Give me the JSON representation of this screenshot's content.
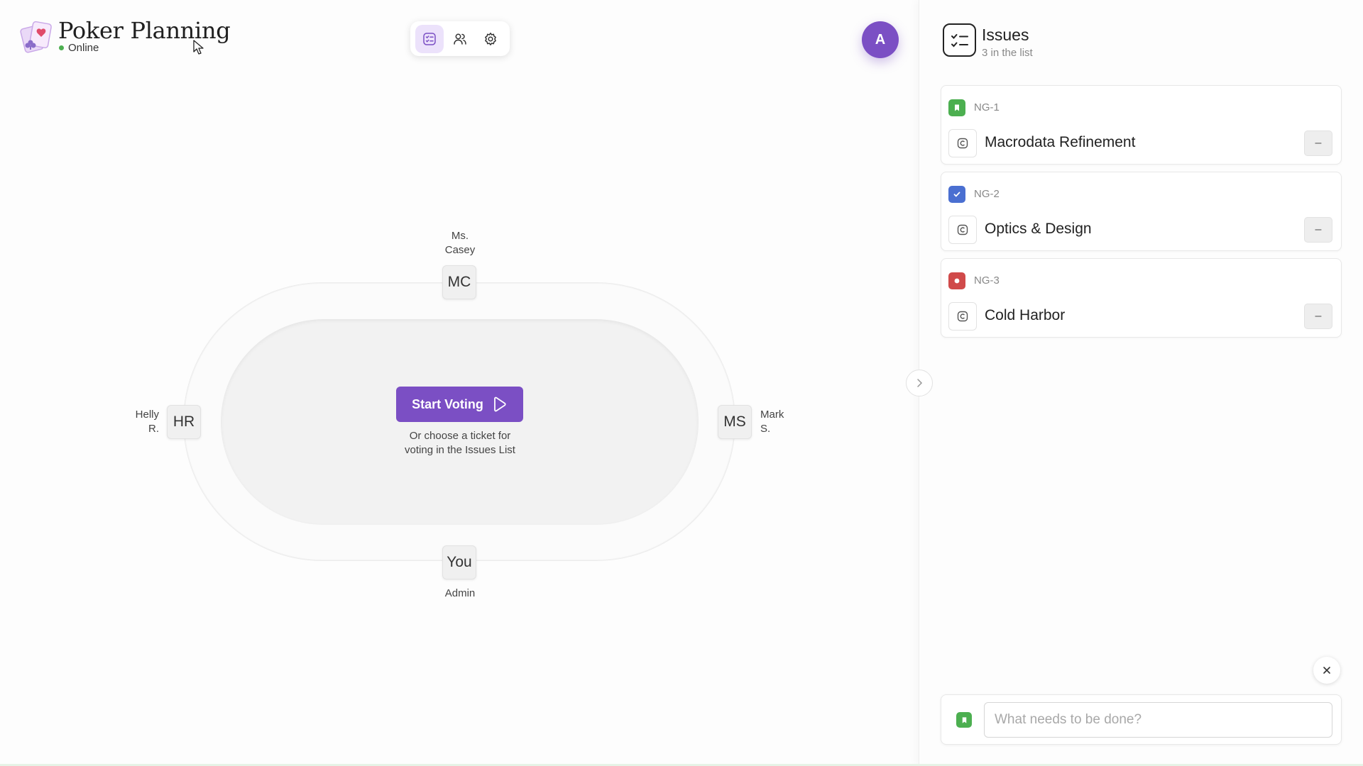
{
  "header": {
    "title": "Poker Planning",
    "status": "Online",
    "user_initial": "A"
  },
  "toolbar": {
    "buttons": [
      {
        "icon": "issues-list-icon",
        "active": true
      },
      {
        "icon": "users-icon",
        "active": false
      },
      {
        "icon": "settings-gear-icon",
        "active": false
      }
    ]
  },
  "table": {
    "start_button_label": "Start Voting",
    "hint_line1": "Or choose a ticket for",
    "hint_line2": "voting in the Issues List"
  },
  "players": {
    "top": {
      "initials": "MC",
      "name_line1": "Ms.",
      "name_line2": "Casey"
    },
    "left": {
      "initials": "HR",
      "name_line1": "Helly",
      "name_line2": "R."
    },
    "right": {
      "initials": "MS",
      "name_line1": "Mark",
      "name_line2": "S."
    },
    "bottom": {
      "initials": "You",
      "name": "Admin"
    }
  },
  "issues": {
    "title": "Issues",
    "count_text": "3 in the list",
    "items": [
      {
        "key": "NG-1",
        "title": "Macrodata Refinement",
        "type": "story",
        "type_color": "#4caf50",
        "menu": "–"
      },
      {
        "key": "NG-2",
        "title": "Optics & Design",
        "type": "task",
        "type_color": "#4a6fd1",
        "menu": "–"
      },
      {
        "key": "NG-3",
        "title": "Cold Harbor",
        "type": "bug",
        "type_color": "#d04a4a",
        "menu": "–"
      }
    ],
    "new_issue_placeholder": "What needs to be done?"
  },
  "colors": {
    "accent": "#7b4fc4",
    "online": "#4caf50"
  }
}
